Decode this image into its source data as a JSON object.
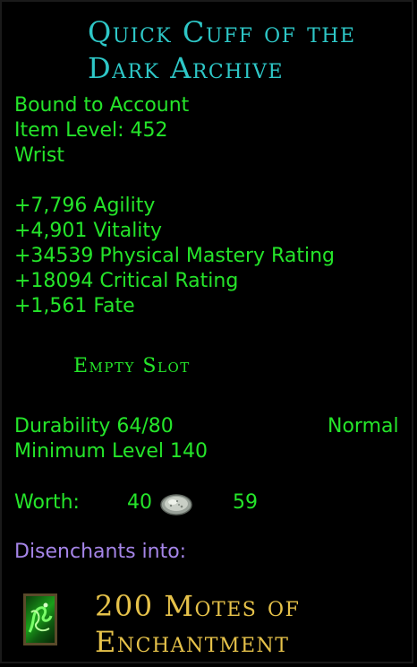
{
  "item": {
    "title_line1": "Quick Cuff of the",
    "title_line2": "Dark Archive",
    "binding": "Bound to Account",
    "item_level": "Item Level: 452",
    "slot_type": "Wrist"
  },
  "stats": [
    "+7,796 Agility",
    "+4,901 Vitality",
    "+34539 Physical Mastery Rating",
    "+18094 Critical Rating",
    "+1,561 Fate"
  ],
  "essence_slot": "Empty Slot",
  "durability": {
    "text": "Durability 64/80",
    "quality": "Normal"
  },
  "minimum_level": "Minimum Level 140",
  "worth": {
    "label": "Worth:",
    "silver": "40",
    "coin_icon": "silver-coin-icon",
    "copper": "59"
  },
  "disenchant": {
    "label": "Disenchants into:",
    "result_line1": "200 Motes of",
    "result_line2": "Enchantment",
    "icon": "mote-of-enchantment-icon"
  },
  "colors": {
    "title": "#2ec7c7",
    "stat_green": "#25e52a",
    "disenchant_label": "#a585e8",
    "mote_gold": "#e6c24a",
    "background": "#000000"
  }
}
